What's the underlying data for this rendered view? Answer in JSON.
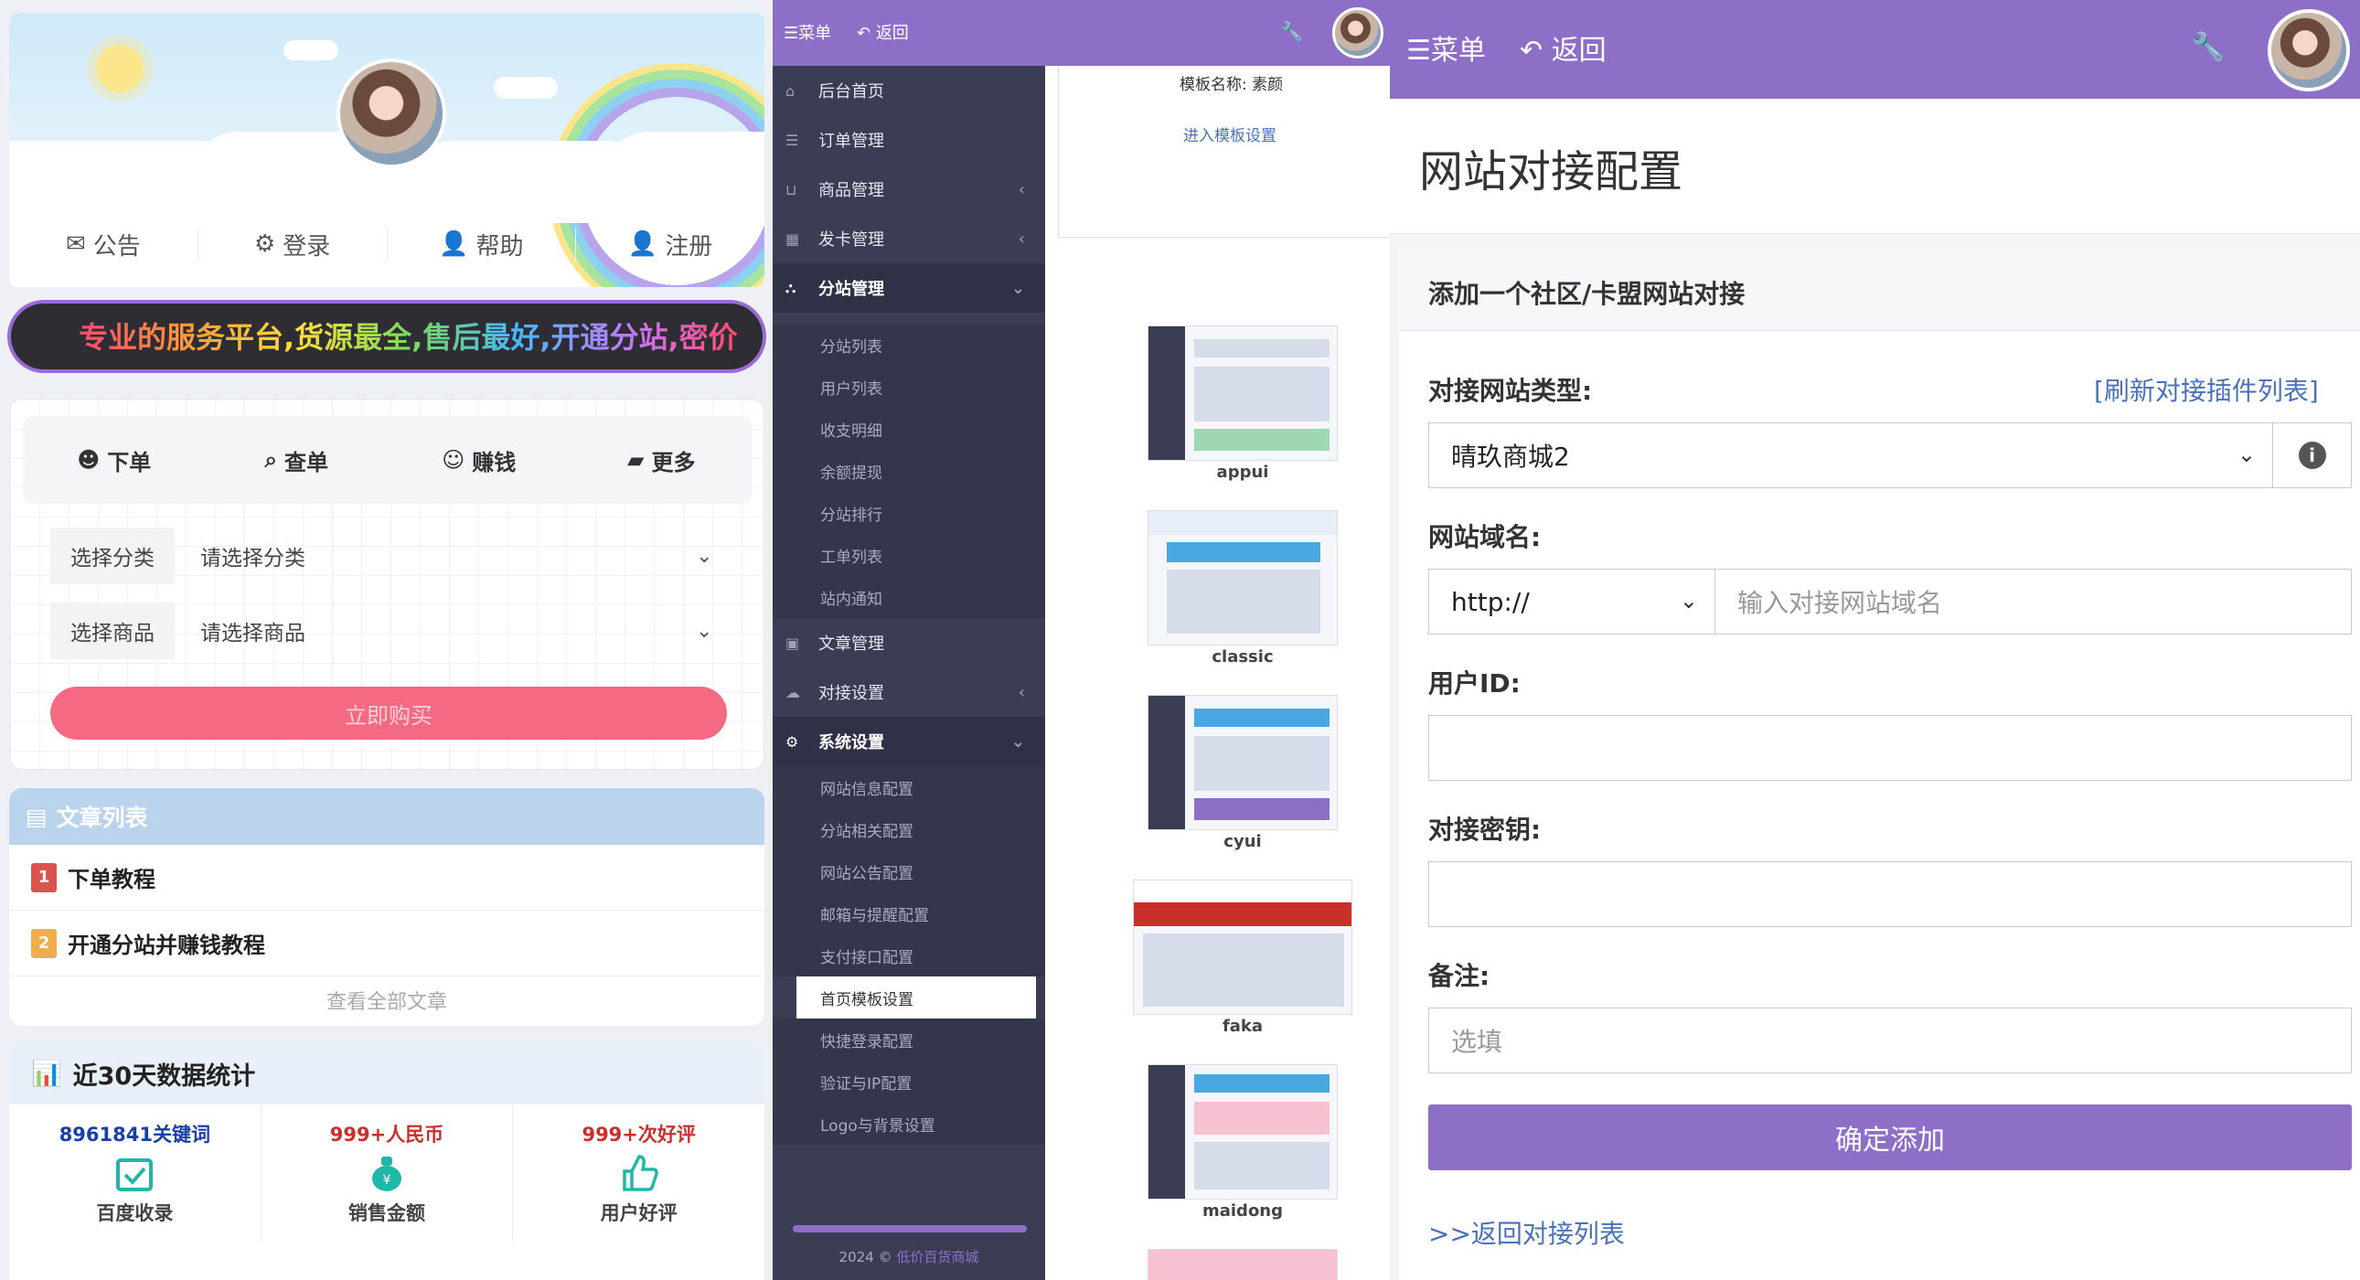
{
  "store": {
    "nav": [
      {
        "icon": "envelope-open-icon",
        "label": "公告"
      },
      {
        "icon": "gears-icon",
        "label": "登录"
      },
      {
        "icon": "user-icon",
        "label": "帮助"
      },
      {
        "icon": "user-icon",
        "label": "注册"
      }
    ],
    "marquee": "专业的服务平台,货源最全,售后最好,开通分站,密价",
    "tabs": [
      {
        "icon": "avatar-icon",
        "label": "下单"
      },
      {
        "icon": "search-icon",
        "label": "查单"
      },
      {
        "icon": "smile-icon",
        "label": "赚钱"
      },
      {
        "icon": "folder-icon",
        "label": "更多"
      }
    ],
    "category": {
      "label": "选择分类",
      "value": "请选择分类"
    },
    "product": {
      "label": "选择商品",
      "value": "请选择商品"
    },
    "buy_label": "立即购买",
    "articles": {
      "title": "文章列表",
      "items": [
        {
          "num": "1",
          "title": "下单教程",
          "color": "#d9534f"
        },
        {
          "num": "2",
          "title": "开通分站并赚钱教程",
          "color": "#f0ad4e"
        }
      ],
      "view_all": "查看全部文章"
    },
    "stats": {
      "title": "近30天数据统计",
      "items": [
        {
          "value": "8961841关键词",
          "label": "百度收录",
          "color": "#1a3ea8",
          "icon": "calendar-check-icon"
        },
        {
          "value": "999+人民币",
          "label": "销售金额",
          "color": "#c9302c",
          "icon": "money-bag-icon"
        },
        {
          "value": "999+次好评",
          "label": "用户好评",
          "color": "#c9302c",
          "icon": "thumbs-up-icon"
        }
      ]
    }
  },
  "admin": {
    "menu_label": "菜单",
    "back_label": "返回",
    "sidebar": [
      {
        "key": "home",
        "icon": "home-icon",
        "label": "后台首页"
      },
      {
        "key": "orders",
        "icon": "list-icon",
        "label": "订单管理"
      },
      {
        "key": "goods",
        "icon": "cart-icon",
        "label": "商品管理",
        "arrow": "‹"
      },
      {
        "key": "cards",
        "icon": "grid-icon",
        "label": "发卡管理",
        "arrow": "‹"
      },
      {
        "key": "sites",
        "icon": "sitemap-icon",
        "label": "分站管理",
        "arrow": "⌄"
      },
      {
        "key": "articles",
        "icon": "book-icon",
        "label": "文章管理"
      },
      {
        "key": "dock",
        "icon": "cloud-icon",
        "label": "对接设置",
        "arrow": "‹"
      },
      {
        "key": "system",
        "icon": "gear-icon",
        "label": "系统设置",
        "arrow": "⌄"
      }
    ],
    "site_sub": [
      "分站列表",
      "用户列表",
      "收支明细",
      "余额提现",
      "分站排行",
      "工单列表",
      "站内通知"
    ],
    "system_sub": [
      "网站信息配置",
      "分站相关配置",
      "网站公告配置",
      "邮箱与提醒配置",
      "支付接口配置",
      "首页模板设置",
      "快捷登录配置",
      "验证与IP配置",
      "Logo与背景设置"
    ],
    "footer_year": "2024 ©",
    "footer_brand": "低价百货商城",
    "template_name": "模板名称: 素颜",
    "template_link": "进入模板设置",
    "templates": [
      "appui",
      "classic",
      "cyui",
      "faka",
      "maidong"
    ]
  },
  "config": {
    "menu_label": "菜单",
    "back_label": "返回",
    "title": "网站对接配置",
    "card_title": "添加一个社区/卡盟网站对接",
    "type_label": "对接网站类型:",
    "refresh_link": "[刷新对接插件列表]",
    "type_value": "晴玖商城2",
    "domain_label": "网站域名:",
    "protocol": "http://",
    "domain_placeholder": "输入对接网站域名",
    "userid_label": "用户ID:",
    "secret_label": "对接密钥:",
    "note_label": "备注:",
    "note_placeholder": "选填",
    "submit_label": "确定添加",
    "back_list": ">>返回对接列表"
  }
}
